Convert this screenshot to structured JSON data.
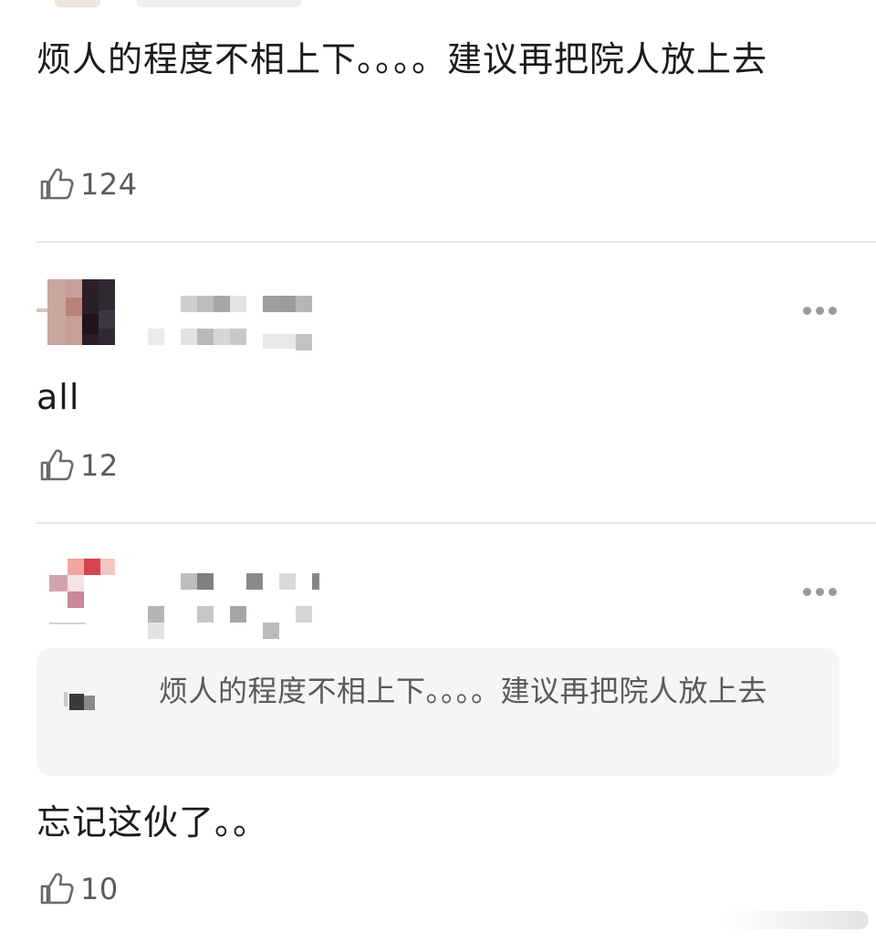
{
  "comments": [
    {
      "text": "烦人的程度不相上下。。。。建议再把院人放上去",
      "likes": "124"
    },
    {
      "text": "all",
      "likes": "12"
    },
    {
      "quote": "烦人的程度不相上下。。。。建议再把院人放上去",
      "text": "忘记这伙了。。",
      "likes": "10"
    }
  ],
  "colors": {
    "text": "#1b1b1b",
    "secondary": "#5b5b5b",
    "quote_bg": "#f5f5f5",
    "divider": "#e6e6e6",
    "icon": "#9a9a9a"
  },
  "icons": {
    "like": "thumbs-up-icon",
    "more": "more-dots-icon"
  }
}
